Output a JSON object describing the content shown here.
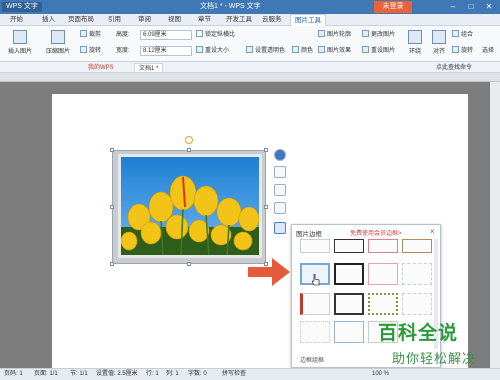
{
  "titlebar": {
    "app": "WPS 文字",
    "title": "文档1 * - WPS 文字",
    "login": "未登录"
  },
  "tabs": [
    "开始",
    "插入",
    "页面布局",
    "引用",
    "审阅",
    "视图",
    "章节",
    "开发工具",
    "云服务",
    "图片工具"
  ],
  "active_tab": "图片工具",
  "ribbon": {
    "insert_pic": "插入图片",
    "compress": "压缩图片",
    "crop": "裁剪",
    "rotate": "旋转",
    "height_label": "高度:",
    "height_value": "6.09厘米",
    "width_label": "宽度:",
    "width_value": "8.12厘米",
    "lock_ratio": "锁定纵横比",
    "reset_size": "重设大小",
    "transparent": "设置透明色",
    "color": "颜色",
    "pic_outline": "图片轮廓",
    "pic_effect": "图片效果",
    "change_pic": "更改图片",
    "reset_pic": "重设图片",
    "wrap": "环绕",
    "align": "对齐",
    "group": "组合",
    "rotate2": "旋转",
    "select": "选择"
  },
  "quickbar": {
    "tab1": "我的WPS",
    "tab2": "文档1 *",
    "search": "点此查找命令"
  },
  "popup": {
    "title": "图片边框",
    "link": "免费使用会员边框>",
    "footer": "边框组框"
  },
  "status": {
    "page": "页码: 1",
    "pages": "页面: 1/1",
    "section": "节: 1/1",
    "setting": "设置值: 2.5厘米",
    "row": "行: 1",
    "col": "列: 1",
    "words": "字数: 0",
    "spell": "拼写检查",
    "zoom": "100 %"
  },
  "watermark": {
    "big": "百科全说",
    "small": "助你轻松解决"
  }
}
